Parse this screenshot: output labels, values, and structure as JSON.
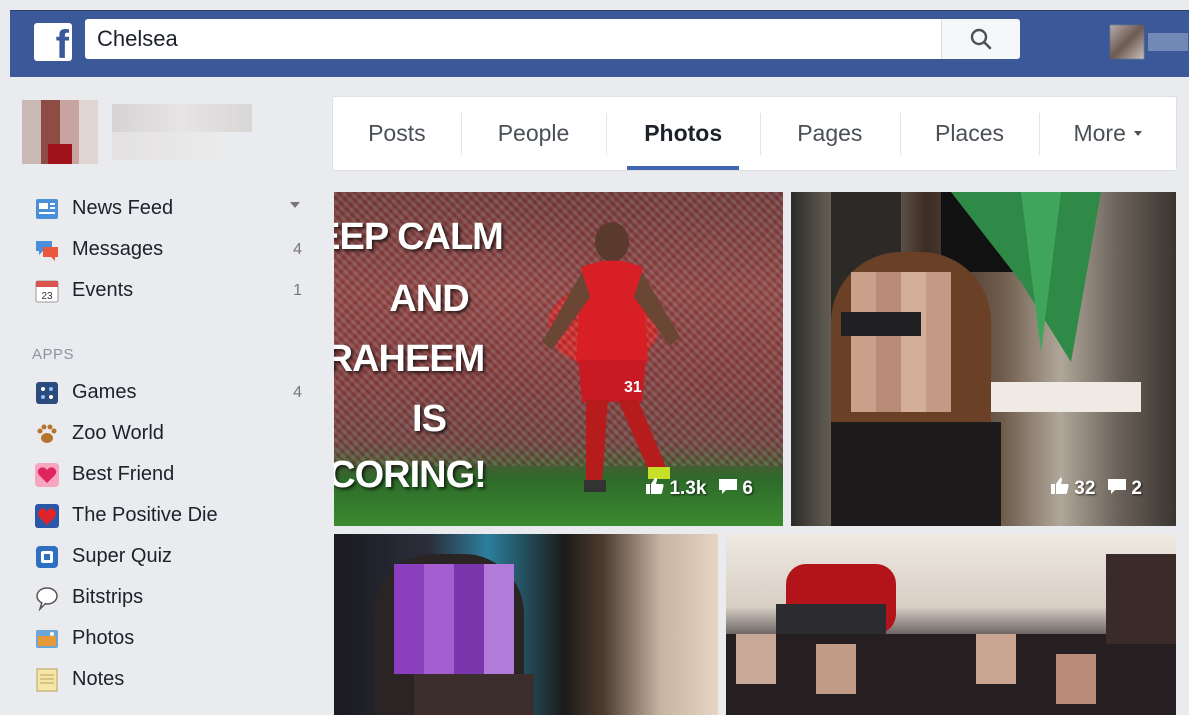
{
  "header": {
    "logo_letter": "f",
    "search_value": "Chelsea"
  },
  "sidebar": {
    "items": [
      {
        "label": "News Feed",
        "icon": "news-feed-icon",
        "count": "",
        "caret": true
      },
      {
        "label": "Messages",
        "icon": "messages-icon",
        "count": "4"
      },
      {
        "label": "Events",
        "icon": "events-icon",
        "icon_text": "23",
        "count": "1"
      }
    ],
    "apps_title": "APPS",
    "apps": [
      {
        "label": "Games",
        "icon": "games-icon",
        "count": "4"
      },
      {
        "label": "Zoo World",
        "icon": "paw-icon",
        "count": ""
      },
      {
        "label": "Best Friend",
        "icon": "heart-icon",
        "count": ""
      },
      {
        "label": "The Positive Die",
        "icon": "positive-die-icon",
        "count": ""
      },
      {
        "label": "Super Quiz",
        "icon": "super-quiz-icon",
        "count": ""
      },
      {
        "label": "Bitstrips",
        "icon": "speech-bubble-icon",
        "count": ""
      },
      {
        "label": "Photos",
        "icon": "photos-icon",
        "count": ""
      },
      {
        "label": "Notes",
        "icon": "notes-icon",
        "count": ""
      }
    ]
  },
  "tabs": [
    {
      "label": "Posts",
      "active": false
    },
    {
      "label": "People",
      "active": false
    },
    {
      "label": "Photos",
      "active": true
    },
    {
      "label": "Pages",
      "active": false
    },
    {
      "label": "Places",
      "active": false
    },
    {
      "label": "More",
      "active": false
    }
  ],
  "photos": {
    "p1": {
      "lines": [
        "EEP CALM",
        "AND",
        "RAHEEM",
        "IS",
        "CORING!"
      ],
      "likes": "1.3k",
      "comments": "6"
    },
    "p2": {
      "likes": "32",
      "comments": "2"
    }
  },
  "colors": {
    "brand": "#3b5998",
    "tab_underline": "#4267b2",
    "background": "#e9ebee"
  }
}
